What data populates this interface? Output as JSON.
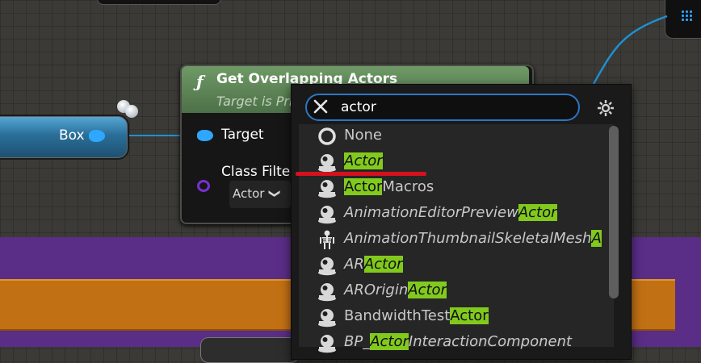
{
  "graph": {
    "box_node_label": "Box",
    "function_node": {
      "icon_glyph": "ƒ",
      "title": "Get Overlapping Actors",
      "subtitle": "Target is Pri",
      "pins": {
        "target_label": "Target",
        "class_filter_label": "Class Filte",
        "class_filter_value": "Actor",
        "class_filter_chevron": "❯"
      }
    }
  },
  "dropdown": {
    "search": {
      "value": "actor",
      "placeholder": ""
    },
    "items": [
      {
        "icon": "none-circle-icon",
        "segments": [
          {
            "text": "None",
            "hl": false
          }
        ],
        "italic": false
      },
      {
        "icon": "actor-pawn-icon",
        "segments": [
          {
            "text": "Actor",
            "hl": true
          }
        ],
        "italic": true
      },
      {
        "icon": "actor-pawn-icon",
        "segments": [
          {
            "text": "Actor",
            "hl": true
          },
          {
            "text": "Macros",
            "hl": false
          }
        ],
        "italic": false
      },
      {
        "icon": "actor-pawn-icon",
        "segments": [
          {
            "text": "AnimationEditorPreview",
            "hl": false
          },
          {
            "text": "Actor",
            "hl": true
          }
        ],
        "italic": true
      },
      {
        "icon": "skeleton-icon",
        "segments": [
          {
            "text": "AnimationThumbnailSkeletalMesh",
            "hl": false
          },
          {
            "text": "A",
            "hl": true
          }
        ],
        "italic": true
      },
      {
        "icon": "actor-pawn-icon",
        "segments": [
          {
            "text": "AR",
            "hl": false
          },
          {
            "text": "Actor",
            "hl": true
          }
        ],
        "italic": true
      },
      {
        "icon": "actor-pawn-icon",
        "segments": [
          {
            "text": "AROrigin",
            "hl": false
          },
          {
            "text": "Actor",
            "hl": true
          }
        ],
        "italic": true
      },
      {
        "icon": "actor-pawn-icon",
        "segments": [
          {
            "text": "BandwidthTest",
            "hl": false
          },
          {
            "text": "Actor",
            "hl": true
          }
        ],
        "italic": false
      },
      {
        "icon": "actor-pawn-icon",
        "segments": [
          {
            "text": "BP_",
            "hl": false
          },
          {
            "text": "Actor",
            "hl": true
          },
          {
            "text": "InteractionComponent",
            "hl": false
          }
        ],
        "italic": true
      }
    ]
  },
  "colors": {
    "accent_blue": "#2b77c3",
    "highlight_green": "#82c91e",
    "node_header_green": "#5e8556",
    "pin_blue": "#2ea7ff",
    "pin_purple": "#7b2fd1",
    "annotation_red": "#d4121e"
  }
}
